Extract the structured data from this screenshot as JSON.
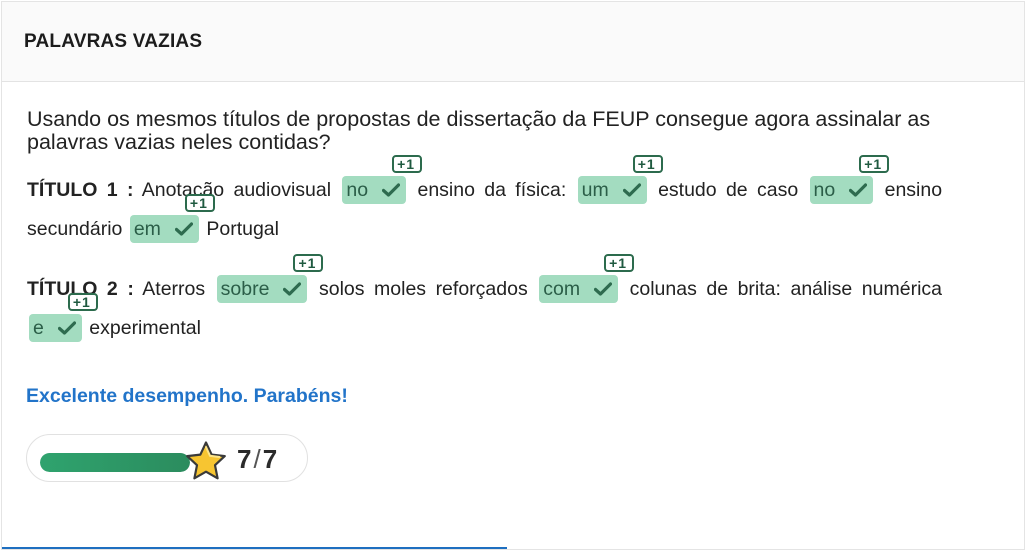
{
  "header": {
    "title": "PALAVRAS VAZIAS"
  },
  "question": "Usando os mesmos títulos de propostas de dissertação da FEUP consegue agora assinalar as palavras vazias neles contidas?",
  "titles": [
    {
      "label": "TÍTULO 1",
      "colon": ":",
      "segments": [
        "Anotação audiovisual",
        "ensino da física",
        ":",
        "estudo de caso",
        "ensino secundário",
        "Portugal"
      ],
      "chips": [
        "no",
        "um",
        "no",
        "em"
      ]
    },
    {
      "label": "TÍTULO 2",
      "colon": ":",
      "segments": [
        "Aterros",
        "solos moles reforçados",
        "colunas de brita",
        ":",
        "análise numérica",
        "experimental"
      ],
      "chips": [
        "sobre",
        "com",
        "e"
      ]
    }
  ],
  "points_badge": "+1",
  "feedback": "Excelente desempenho. Parabéns!",
  "score": {
    "current": "7",
    "separator": "/",
    "total": "7",
    "progress_fraction": 1.0
  },
  "colors": {
    "chip_bg": "#a3dcc0",
    "badge_border": "#2c6b4d",
    "feedback": "#2274c9",
    "progress": "#2fa36e"
  },
  "icons": {
    "chip": "check-icon",
    "score": "star-icon"
  }
}
